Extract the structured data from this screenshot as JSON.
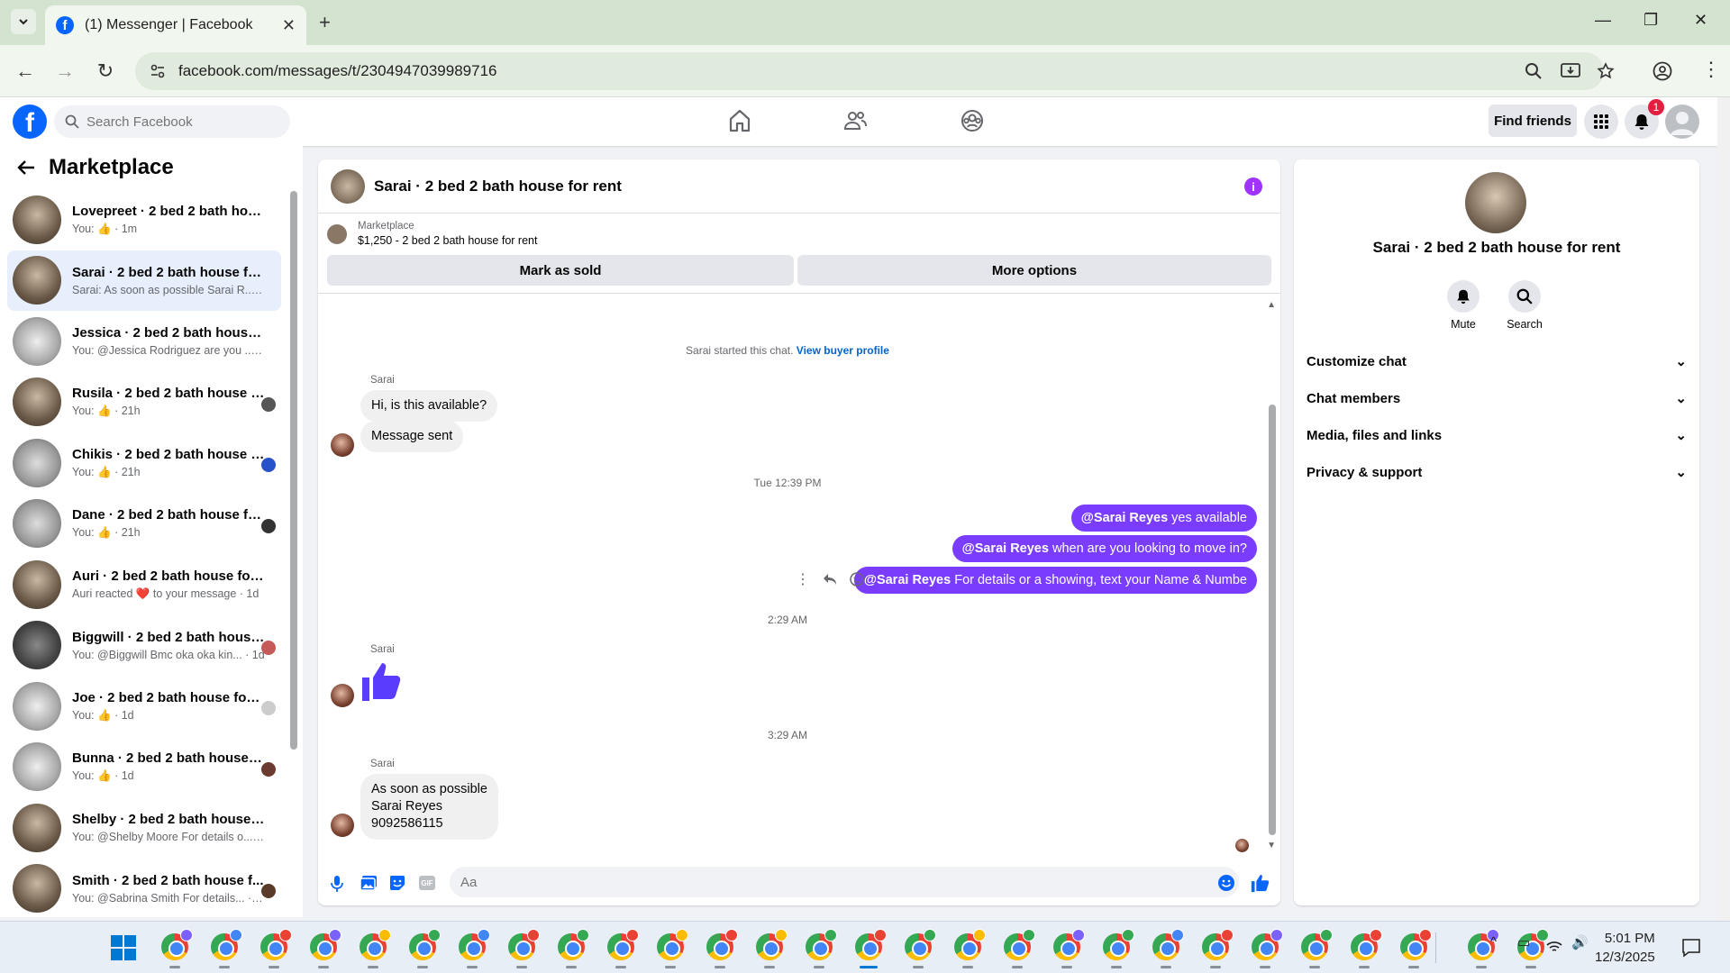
{
  "browser": {
    "tab_title": "(1) Messenger | Facebook",
    "url": "facebook.com/messages/t/2304947039989716"
  },
  "fb": {
    "search_placeholder": "Search Facebook",
    "find_friends": "Find friends",
    "notif_count": "1"
  },
  "left": {
    "title": "Marketplace",
    "conversations": [
      {
        "name": "Lovepreet · 2 bed 2 bath house ...",
        "preview": "You: 👍 · 1m"
      },
      {
        "name": "Sarai · 2 bed 2 bath house for r...",
        "preview": "Sarai: As soon as possible Sarai R... · 13h"
      },
      {
        "name": "Jessica · 2 bed 2 bath house for...",
        "preview": "You: @Jessica Rodriguez are you ... · 16h"
      },
      {
        "name": "Rusila · 2 bed 2 bath house f...",
        "preview": "You: 👍 · 21h"
      },
      {
        "name": "Chikis · 2 bed 2 bath house f...",
        "preview": "You: 👍 · 21h"
      },
      {
        "name": "Dane · 2 bed 2 bath house fo...",
        "preview": "You: 👍 · 21h"
      },
      {
        "name": "Auri · 2 bed 2 bath house for rent",
        "preview": "Auri reacted ❤️ to your message · 1d"
      },
      {
        "name": "Biggwill · 2 bed 2 bath house...",
        "preview": "You: @Biggwill Bmc oka oka kin... · 1d"
      },
      {
        "name": "Joe · 2 bed 2 bath house for r...",
        "preview": "You: 👍 · 1d"
      },
      {
        "name": "Bunna · 2 bed 2 bath house f...",
        "preview": "You: 👍 · 1d"
      },
      {
        "name": "Shelby · 2 bed 2 bath house for...",
        "preview": "You: @Shelby Moore For details o... · 1d"
      },
      {
        "name": "Smith · 2 bed 2 bath house f...",
        "preview": "You: @Sabrina Smith For details... · 1d"
      }
    ]
  },
  "chat": {
    "title": "Sarai · 2 bed 2 bath house for rent",
    "marketplace_label": "Marketplace",
    "listing": "$1,250 - 2 bed 2 bath house for rent",
    "mark_sold": "Mark as sold",
    "more_options": "More options",
    "started_text": "Sarai started this chat.",
    "view_profile": "View buyer profile",
    "sender": "Sarai",
    "msg1": "Hi, is this available?",
    "msg2": "Message sent",
    "time1": "Tue 12:39 PM",
    "out1_mention": "@Sarai Reyes",
    "out1_text": " yes available",
    "out2_mention": "@Sarai Reyes",
    "out2_text": " when are you looking to move in?",
    "out3_mention": "@Sarai Reyes",
    "out3_text": " For details or a showing, text your Name & Numbe",
    "time2": "2:29 AM",
    "time3": "3:29 AM",
    "last_line1": "As soon as possible",
    "last_line2": "Sarai Reyes",
    "last_line3": "9092586115",
    "composer_placeholder": "Aa"
  },
  "right": {
    "name": "Sarai · 2 bed 2 bath house for rent",
    "mute": "Mute",
    "search": "Search",
    "sections": [
      "Customize chat",
      "Chat members",
      "Media, files and links",
      "Privacy & support"
    ]
  },
  "taskbar": {
    "time": "5:01 PM",
    "date": "12/3/2025"
  }
}
